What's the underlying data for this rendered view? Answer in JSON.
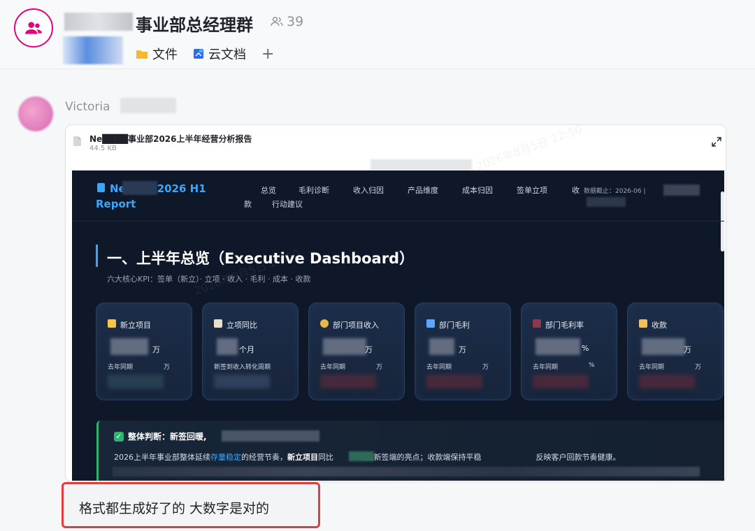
{
  "header": {
    "group_title": "事业部总经理群",
    "member_count": "39",
    "tools": [
      {
        "label": "文件",
        "icon": "folder-icon"
      },
      {
        "label": "云文档",
        "icon": "cloud-doc-icon"
      }
    ],
    "add_label": "+"
  },
  "message": {
    "sender": "Victoria",
    "file_name": "Ne████事业部2026上半年经营分析报告",
    "file_size": "44.5 KB",
    "watermark": "2026年8月5日 22:50"
  },
  "report": {
    "brand_line1": "Ne      BU · 2026 H1",
    "brand_line2": "Report",
    "nav_row1": [
      "总览",
      "毛利诊断",
      "收入归因",
      "产品维度",
      "成本归因",
      "签单立项",
      "收"
    ],
    "nav_row2": [
      "款",
      "行动建议"
    ],
    "data_cutoff": "数据截止：2026-06 |",
    "section_title": "一、上半年总览（Executive Dashboard）",
    "section_subtitle": "六大核心KPI：签单（新立）· 立项 · 收入 · 毛利 · 成本 · 收款",
    "kpis": [
      {
        "title": "新立项目",
        "unit": "万",
        "compare": "去年同期",
        "compare_unit": "万",
        "icon_color": "#f5c64a"
      },
      {
        "title": "立项同比",
        "unit": "个月",
        "compare": "新签到收入转化周期",
        "compare_unit": "",
        "icon_color": "#e8e0c8"
      },
      {
        "title": "部门项目收入",
        "unit": "万",
        "compare": "去年同期",
        "compare_unit": "万",
        "icon_color": "#e8b64a"
      },
      {
        "title": "部门毛利",
        "unit": "万",
        "compare": "去年同期",
        "compare_unit": "万",
        "icon_color": "#5aa9ff"
      },
      {
        "title": "部门毛利率",
        "unit": "%",
        "compare": "去年同期",
        "compare_unit": "%",
        "icon_color": "#8a3a4a"
      },
      {
        "title": "收款",
        "unit": "万",
        "compare": "去年同期",
        "compare_unit": "万",
        "icon_color": "#f0c060"
      }
    ],
    "judgement_title": "整体判断：新签回暖,",
    "judgement_text_1": "2026上半年事业部整体延续",
    "judgement_highlight": "存量稳定",
    "judgement_text_2": "的经营节奏，",
    "judgement_bold": "新立项目",
    "judgement_text_3": "同比",
    "judgement_text_4": "%是新签端的亮点；收款端保持平稳",
    "judgement_text_5": "反映客户回款节奏健康。"
  },
  "reply": {
    "text": "格式都生成好了的 大数字是对的"
  }
}
